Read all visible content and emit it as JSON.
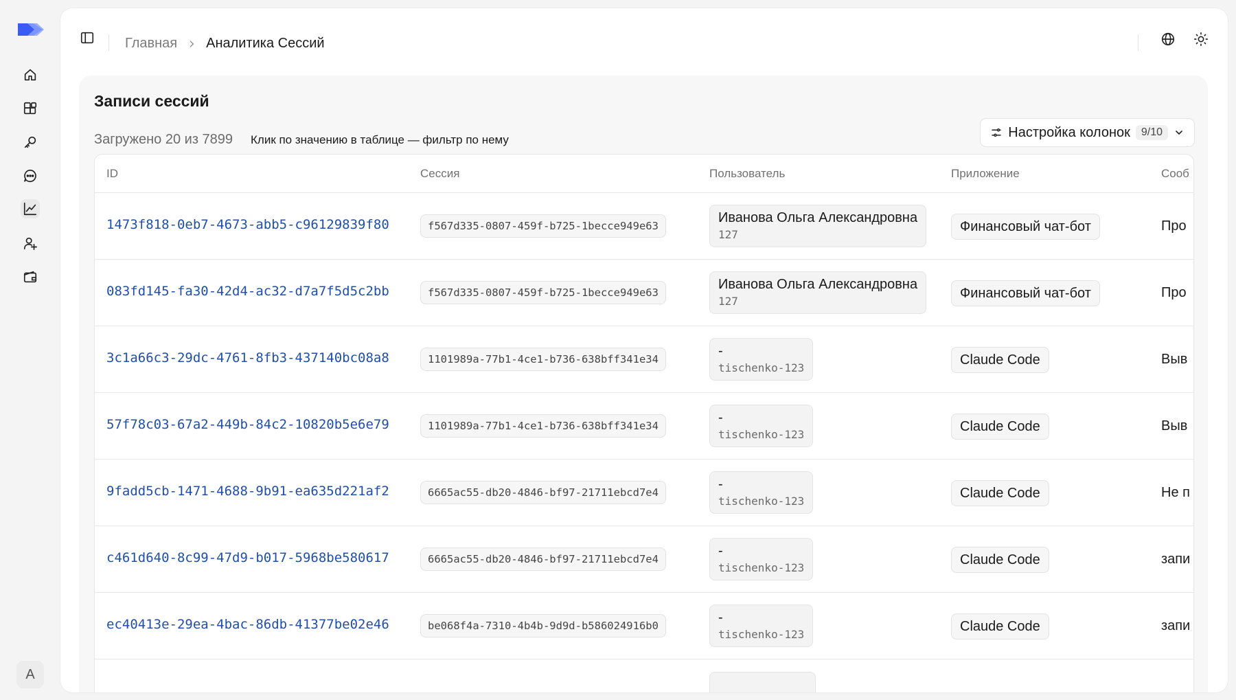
{
  "nav": {
    "items": [
      "home-icon",
      "blocks-icon",
      "key-icon",
      "chat-icon",
      "chart-icon",
      "user-plus-icon",
      "wallet-icon"
    ],
    "active": "chart-icon",
    "avatar_letter": "A",
    "brand_color": "#3b5bf5"
  },
  "breadcrumb": {
    "home": "Главная",
    "current": "Аналитика Сессий"
  },
  "header": {
    "globe_icon": "globe-icon",
    "theme_icon": "sun-icon"
  },
  "card": {
    "title": "Записи сессий",
    "loaded": "Загружено 20 из 7899",
    "hint": "Клик по значению в таблице — фильтр по нему",
    "columns_button": "Настройка колонок",
    "columns_count": "9/10"
  },
  "table": {
    "headers": [
      "ID",
      "Сессия",
      "Пользователь",
      "Приложение",
      "Сооб"
    ],
    "rows": [
      {
        "id": "1473f818-0eb7-4673-abb5-c96129839f80",
        "session": "f567d335-0807-459f-b725-1becce949e63",
        "user_name": "Иванова Ольга Александровна",
        "user_sub": "127",
        "app": "Финансовый чат-бот",
        "msg": "Про"
      },
      {
        "id": "083fd145-fa30-42d4-ac32-d7a7f5d5c2bb",
        "session": "f567d335-0807-459f-b725-1becce949e63",
        "user_name": "Иванова Ольга Александровна",
        "user_sub": "127",
        "app": "Финансовый чат-бот",
        "msg": "Про"
      },
      {
        "id": "3c1a66c3-29dc-4761-8fb3-437140bc08a8",
        "session": "1101989a-77b1-4ce1-b736-638bff341e34",
        "user_name": "-",
        "user_sub": "tischenko-123",
        "app": "Claude Code",
        "msg": "Выв"
      },
      {
        "id": "57f78c03-67a2-449b-84c2-10820b5e6e79",
        "session": "1101989a-77b1-4ce1-b736-638bff341e34",
        "user_name": "-",
        "user_sub": "tischenko-123",
        "app": "Claude Code",
        "msg": "Выв"
      },
      {
        "id": "9fadd5cb-1471-4688-9b91-ea635d221af2",
        "session": "6665ac55-db20-4846-bf97-21711ebcd7e4",
        "user_name": "-",
        "user_sub": "tischenko-123",
        "app": "Claude Code",
        "msg": "Не п"
      },
      {
        "id": "c461d640-8c99-47d9-b017-5968be580617",
        "session": "6665ac55-db20-4846-bf97-21711ebcd7e4",
        "user_name": "-",
        "user_sub": "tischenko-123",
        "app": "Claude Code",
        "msg": "запи"
      },
      {
        "id": "ec40413e-29ea-4bac-86db-41377be02e46",
        "session": "be068f4a-7310-4b4b-9d9d-b586024916b0",
        "user_name": "-",
        "user_sub": "tischenko-123",
        "app": "Claude Code",
        "msg": "запи"
      }
    ]
  }
}
